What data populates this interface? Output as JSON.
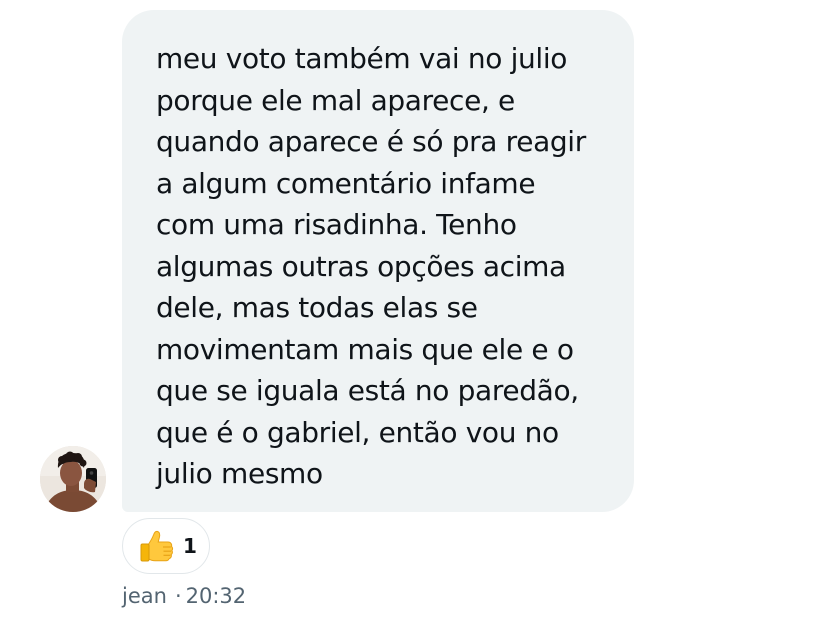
{
  "message": {
    "text": "meu voto também vai no julio\nporque ele mal aparece, e\nquando aparece é só pra reagir\na algum comentário infame\ncom uma risadinha. Tenho\nalgumas outras opções acima\ndele, mas todas elas se\nmovimentam mais que ele e o\nque se iguala está no paredão,\nque é o gabriel, então vou no\njulio mesmo",
    "bubble_color": "#eff3f4",
    "text_color": "#0f1419"
  },
  "reaction": {
    "emoji_icon": "thumbs-up-icon",
    "count": "1"
  },
  "meta": {
    "sender": "jean",
    "separator": "·",
    "time": "20:32",
    "color": "#536471"
  },
  "avatar": {
    "icon": "user-avatar-photo"
  }
}
